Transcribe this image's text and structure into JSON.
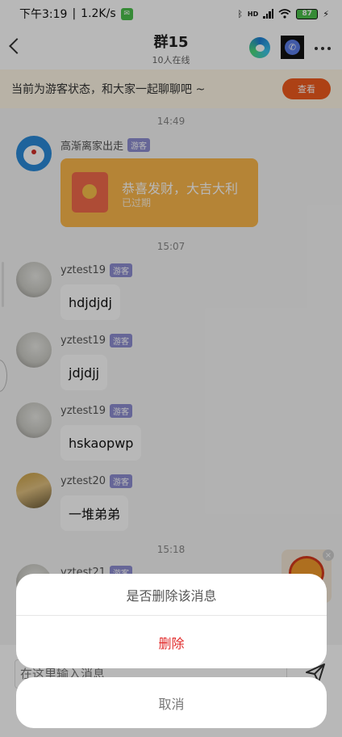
{
  "status_bar": {
    "time": "下午3:19",
    "speed": "1.2K/s",
    "network": "HD",
    "battery": "87"
  },
  "header": {
    "title": "群15",
    "subtitle": "10人在线"
  },
  "banner": {
    "text": "当前为游客状态，和大家一起聊聊吧 ~",
    "button": "查看"
  },
  "messages": {
    "time1": "14:49",
    "time2": "15:07",
    "time3": "15:18",
    "m1": {
      "name": "高渐离家出走",
      "badge": "游客",
      "rp_title": "恭喜发财，大吉大利",
      "rp_sub": "已过期"
    },
    "m2": {
      "name": "yztest19",
      "badge": "游客",
      "text": "hdjdjdj"
    },
    "m3": {
      "name": "yztest19",
      "badge": "游客",
      "text": "jdjdjj"
    },
    "m4": {
      "name": "yztest19",
      "badge": "游客",
      "text": "hskaopwp"
    },
    "m5": {
      "name": "yztest20",
      "badge": "游客",
      "text": "一堆弟弟"
    },
    "m6": {
      "name": "yztest21",
      "badge": "游客"
    }
  },
  "input": {
    "placeholder": "在这里输入消息"
  },
  "dialog": {
    "question": "是否删除该消息",
    "delete": "删除",
    "cancel": "取消"
  },
  "colors": {
    "accent": "#f05a1e",
    "delete": "#e12a2a",
    "red_packet": "#fbb74c",
    "guest_badge": "#8e8ed2"
  },
  "icons": [
    "back-icon",
    "edge-browser-icon",
    "phone-app-icon",
    "more-icon",
    "send-icon",
    "close-icon",
    "bluetooth-icon",
    "wifi-icon",
    "signal-icon",
    "battery-icon",
    "wechat-icon",
    "charging-icon"
  ]
}
